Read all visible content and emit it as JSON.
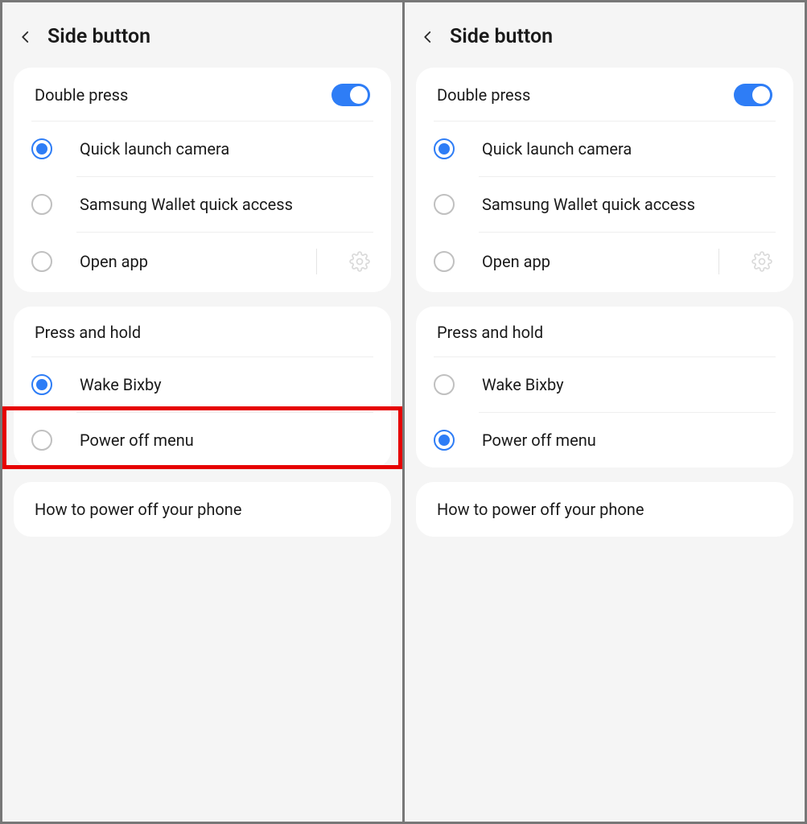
{
  "left": {
    "title": "Side button",
    "double_press_label": "Double press",
    "double_press_on": true,
    "options_dp": [
      "Quick launch camera",
      "Samsung Wallet quick access",
      "Open app"
    ],
    "dp_selected": 0,
    "press_hold_label": "Press and hold",
    "options_ph": [
      "Wake Bixby",
      "Power off menu"
    ],
    "ph_selected": 0,
    "howto_label": "How to power off your phone",
    "highlighted_row": 1
  },
  "right": {
    "title": "Side button",
    "double_press_label": "Double press",
    "double_press_on": true,
    "options_dp": [
      "Quick launch camera",
      "Samsung Wallet quick access",
      "Open app"
    ],
    "dp_selected": 0,
    "press_hold_label": "Press and hold",
    "options_ph": [
      "Wake Bixby",
      "Power off menu"
    ],
    "ph_selected": 1,
    "howto_label": "How to power off your phone"
  }
}
